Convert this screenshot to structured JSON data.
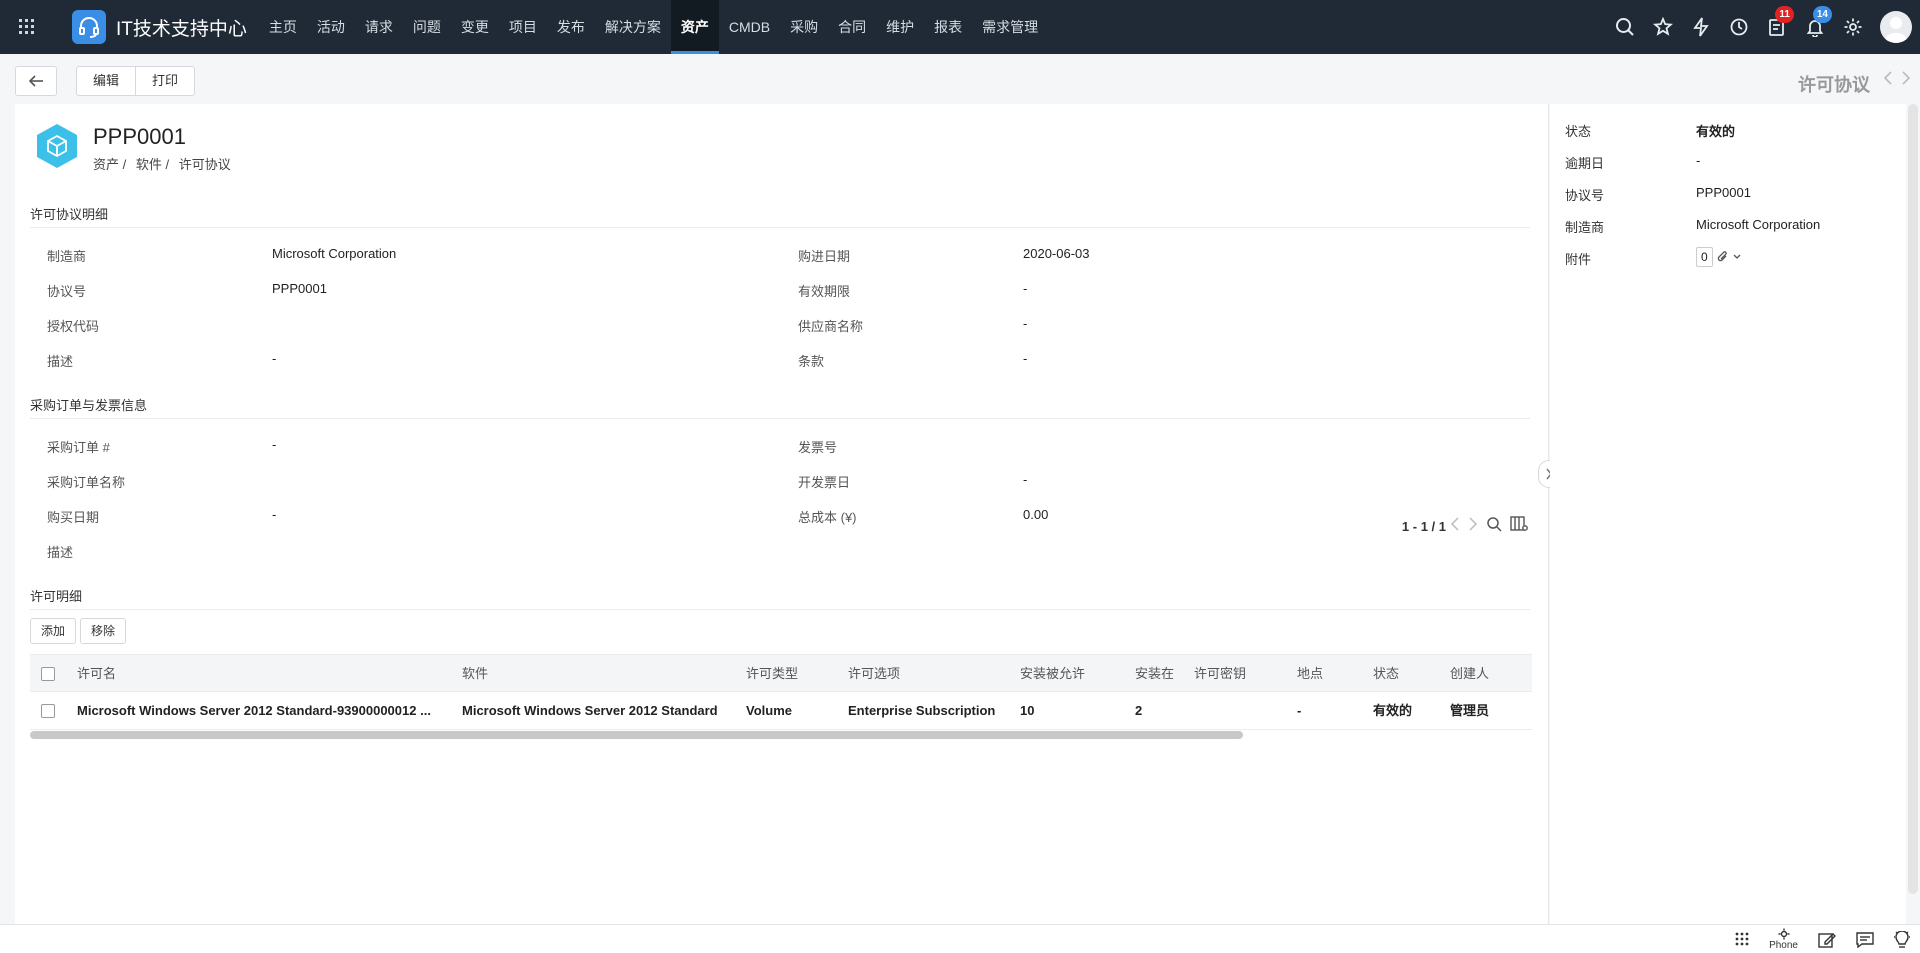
{
  "brand": {
    "title": "IT技术支持中心"
  },
  "nav": {
    "items": [
      "主页",
      "活动",
      "请求",
      "问题",
      "变更",
      "项目",
      "发布",
      "解决方案",
      "资产",
      "CMDB",
      "采购",
      "合同",
      "维护",
      "报表",
      "需求管理"
    ],
    "active": "资产"
  },
  "top_icons": [
    "search-icon",
    "star-icon",
    "lightning-icon",
    "history-icon",
    "tasks-icon",
    "bell-icon",
    "gear-icon"
  ],
  "badges": {
    "tasks": "11",
    "notifications": "14"
  },
  "toolbar": {
    "edit": "编辑",
    "print": "打印",
    "record_type": "许可协议"
  },
  "header": {
    "asset_id": "PPP0001",
    "breadcrumb": [
      "资产 /",
      "软件 /",
      "许可协议"
    ]
  },
  "sections": {
    "license_agreement_details": "许可协议明细",
    "po_invoice": "采购订单与发票信息",
    "license_details": "许可明细"
  },
  "details": {
    "manufacturer_label": "制造商",
    "manufacturer": "Microsoft Corporation",
    "agreement_no_label": "协议号",
    "agreement_no": "PPP0001",
    "auth_code_label": "授权代码",
    "auth_code": "",
    "description_label": "描述",
    "description": "-",
    "purchase_date_label": "购进日期",
    "purchase_date": "2020-06-03",
    "validity_label": "有效期限",
    "validity": "-",
    "vendor_label": "供应商名称",
    "vendor": "-",
    "terms_label": "条款",
    "terms": "-"
  },
  "po": {
    "po_no_label": "采购订单 #",
    "po_no": "-",
    "po_name_label": "采购订单名称",
    "po_name": "",
    "buy_date_label": "购买日期",
    "buy_date": "-",
    "desc_label": "描述",
    "desc": "",
    "invoice_no_label": "发票号",
    "invoice_no": "",
    "invoice_date_label": "开发票日",
    "invoice_date": "-",
    "total_cost_label": "总成本 (¥)",
    "total_cost": "0.00"
  },
  "license_table": {
    "add": "添加",
    "remove": "移除",
    "pager": "1 - 1 / 1",
    "columns": [
      "许可名",
      "软件",
      "许可类型",
      "许可选项",
      "安装被允许",
      "安装在",
      "许可密钥",
      "地点",
      "状态",
      "创建人"
    ],
    "rows": [
      [
        "Microsoft Windows Server 2012 Standard-93900000012 ...",
        "Microsoft Windows Server 2012 Standard",
        "Volume",
        "Enterprise Subscription",
        "10",
        "2",
        "",
        "-",
        "有效的",
        "管理员"
      ]
    ]
  },
  "side": {
    "status_label": "状态",
    "status": "有效的",
    "expiry_label": "逾期日",
    "expiry": "-",
    "agreement_label": "协议号",
    "agreement": "PPP0001",
    "manufacturer_label": "制造商",
    "manufacturer": "Microsoft Corporation",
    "attachment_label": "附件",
    "attachment_count": "0"
  },
  "bottom": {
    "phone": "Phone"
  },
  "colors": {
    "nav_bg": "#1f2a36",
    "accent": "#3a8ee6",
    "badge_red": "#e02424",
    "badge_blue": "#3a8ee6",
    "asset_icon": "#3cc0ea"
  }
}
